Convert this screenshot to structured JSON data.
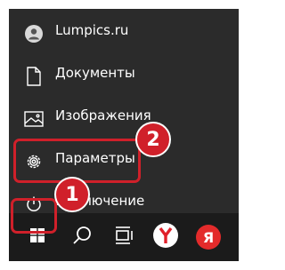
{
  "menu": {
    "items": [
      {
        "label": "Lumpics.ru",
        "icon": "user-icon"
      },
      {
        "label": "Документы",
        "icon": "document-icon"
      },
      {
        "label": "Изображения",
        "icon": "image-icon"
      },
      {
        "label": "Параметры",
        "icon": "gear-icon"
      },
      {
        "label": "Выключение",
        "icon": "power-icon"
      }
    ]
  },
  "taskbar": {
    "buttons": [
      {
        "name": "start-button",
        "icon": "windows-icon"
      },
      {
        "name": "search-button",
        "icon": "search-icon"
      },
      {
        "name": "task-view-button",
        "icon": "task-view-icon"
      },
      {
        "name": "yandex-browser-button",
        "icon": "yandex-browser-icon"
      },
      {
        "name": "yandex-button",
        "icon": "yandex-icon",
        "text": "Я"
      }
    ]
  },
  "annotations": {
    "step1": "1",
    "step2": "2"
  },
  "colors": {
    "menu_bg": "#2b2b2b",
    "taskbar_bg": "#1b1b1b",
    "highlight": "#d0202a",
    "text": "#ffffff"
  }
}
